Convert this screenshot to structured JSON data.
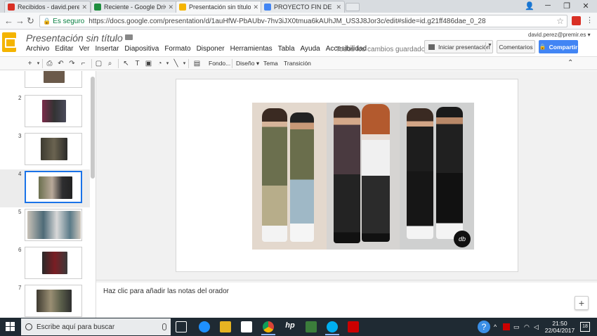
{
  "browser": {
    "tabs": [
      {
        "label": "Recibidos - david.perez@",
        "icon": "gmail-icon",
        "color": "#d93025"
      },
      {
        "label": "Reciente - Google Drive",
        "icon": "drive-icon",
        "color": "#1e8e3e"
      },
      {
        "label": "Presentación sin título -",
        "icon": "slides-icon",
        "color": "#f4b400"
      },
      {
        "label": "PROYECTO FIN DE CICLO",
        "icon": "docs-icon",
        "color": "#4285f4"
      }
    ],
    "secure_label": "Es seguro",
    "url": "https://docs.google.com/presentation/d/1auHfW-PbAUbv-7hv3iJX0tmua6kAUhJM_US3J8Jor3c/edit#slide=id.g21ff486dae_0_28"
  },
  "docs": {
    "title": "Presentación sin título",
    "menu": [
      "Archivo",
      "Editar",
      "Ver",
      "Insertar",
      "Diapositiva",
      "Formato",
      "Disponer",
      "Herramientas",
      "Tabla",
      "Ayuda",
      "Accesibilidad"
    ],
    "saved_status": "Todos los cambios guardados ...",
    "user_email": "david.perez@premir.es",
    "present_label": "Iniciar presentación",
    "comments_label": "Comentarios",
    "share_label": "Compartir",
    "brand_color": "#f4b400",
    "accent_color": "#4285f4"
  },
  "toolbar": {
    "background_label": "Fondo...",
    "design_label": "Diseño",
    "theme_label": "Tema",
    "transition_label": "Transición"
  },
  "filmstrip": {
    "slides": [
      "2",
      "3",
      "4",
      "5",
      "6",
      "7"
    ],
    "selected": "4"
  },
  "slide": {
    "logo_text": "db"
  },
  "notes": {
    "placeholder": "Haz clic para añadir las notas del orador"
  },
  "taskbar": {
    "search_placeholder": "Escribe aquí para buscar",
    "time": "21:50",
    "date": "22/04/2017",
    "notification_count": "18"
  }
}
